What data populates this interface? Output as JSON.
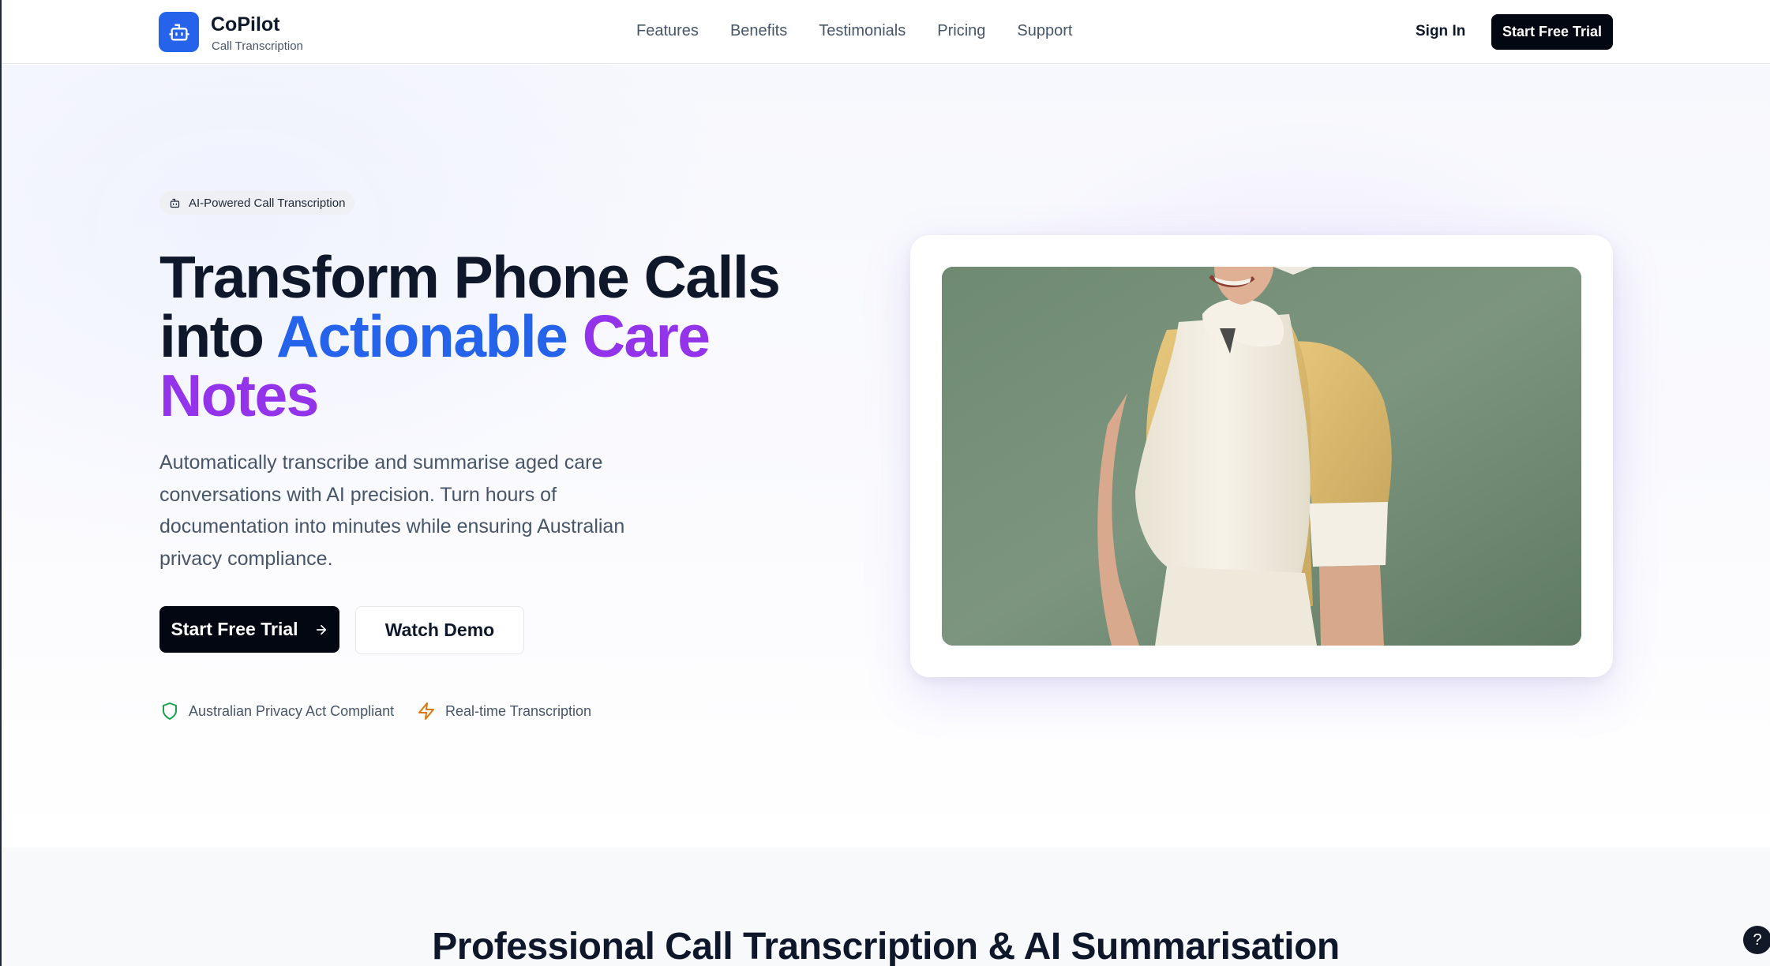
{
  "nav": {
    "brand_name": "CoPilot",
    "brand_sub": "Call Transcription",
    "links": [
      "Features",
      "Benefits",
      "Testimonials",
      "Pricing",
      "Support"
    ],
    "sign_in": "Sign In",
    "cta": "Start Free Trial"
  },
  "hero": {
    "badge": "AI-Powered Call Transcription",
    "headline_1": "Transform Phone Calls",
    "headline_2": "into ",
    "headline_blue": "Actionable",
    "headline_purple_1": "Care",
    "headline_purple_2": "Notes",
    "subtext": "Automatically transcribe and summarise aged care conversations with AI precision. Turn hours of documentation into minutes while ensuring Australian privacy compliance.",
    "primary_button": "Start Free Trial",
    "secondary_button": "Watch Demo",
    "trust_1": "Australian Privacy Act Compliant",
    "trust_2": "Real-time Transcription"
  },
  "section2": {
    "title": "Professional Call Transcription & AI Summarisation"
  },
  "help_button": "?",
  "colors": {
    "accent_blue": "#2563eb",
    "accent_purple": "#9333ea",
    "dark": "#030712",
    "shield_green": "#16a34a",
    "bolt_amber": "#d97706"
  },
  "icons": {
    "logo": "bot-icon",
    "badge": "bot-icon",
    "arrow": "arrow-right-icon",
    "trust_1": "shield-icon",
    "trust_2": "zap-icon"
  }
}
